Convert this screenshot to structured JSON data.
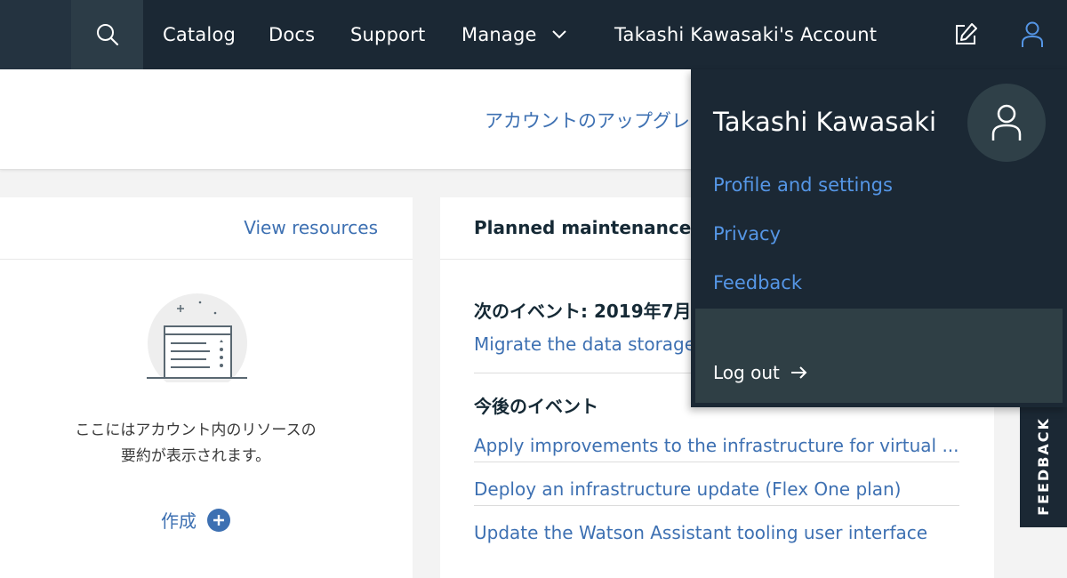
{
  "nav": {
    "items": [
      {
        "label": "Catalog"
      },
      {
        "label": "Docs"
      },
      {
        "label": "Support"
      },
      {
        "label": "Manage"
      }
    ],
    "account": "Takashi Kawasaki's Account"
  },
  "banner": {
    "link": "アカウントのアップグレ"
  },
  "resources": {
    "view_link": "View resources",
    "empty_line1": "ここにはアカウント内のリソースの",
    "empty_line2": "要約が表示されます。",
    "create_label": "作成"
  },
  "maintenance": {
    "title": "Planned maintenance",
    "next_event_label": "次のイベント: 2019年7月",
    "next_event_link": "Migrate the data storage",
    "upcoming_label": "今後のイベント",
    "upcoming": [
      "Apply improvements to the infrastructure for virtual ...",
      "Deploy an infrastructure update (Flex One plan)",
      "Update the Watson Assistant tooling user interface"
    ]
  },
  "feedback_tab": "FEEDBACK",
  "profile_menu": {
    "name": "Takashi Kawasaki",
    "links": [
      "Profile and settings",
      "Privacy",
      "Feedback"
    ],
    "logout": "Log out"
  },
  "colors": {
    "nav_bg": "#1b2834",
    "link": "#3d70b2",
    "menu_link": "#5596e6"
  },
  "icons": [
    "search-icon",
    "chevron-down-icon",
    "edit-icon",
    "user-icon",
    "plus-icon",
    "arrow-right-icon"
  ]
}
